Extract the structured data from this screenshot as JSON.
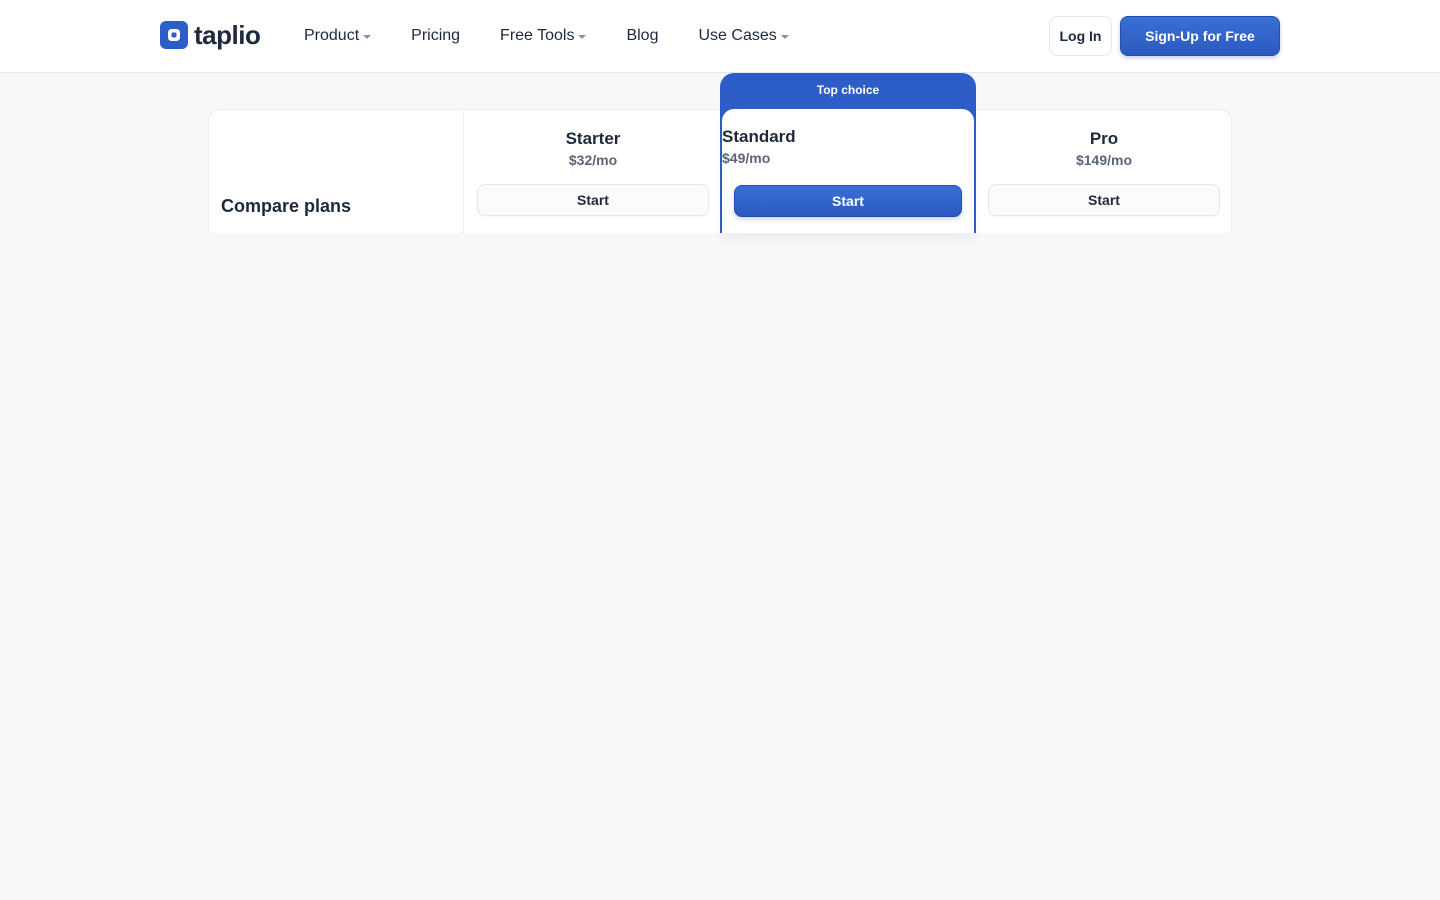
{
  "brand": {
    "name": "taplio",
    "accent": "#2d5ec7"
  },
  "nav": {
    "items": [
      {
        "label": "Product",
        "has_dropdown": true
      },
      {
        "label": "Pricing",
        "has_dropdown": false
      },
      {
        "label": "Free Tools",
        "has_dropdown": true
      },
      {
        "label": "Blog",
        "has_dropdown": false
      },
      {
        "label": "Use Cases",
        "has_dropdown": true
      }
    ],
    "login_label": "Log In",
    "signup_label": "Sign-Up for Free"
  },
  "compare": {
    "title": "Compare plans",
    "featured_badge": "Top choice",
    "plans": [
      {
        "name": "Starter",
        "price": "$32/mo",
        "cta": "Start",
        "featured": false
      },
      {
        "name": "Standard",
        "price": "$49/mo",
        "cta": "Start",
        "featured": true
      },
      {
        "name": "Pro",
        "price": "$149/mo",
        "cta": "Start",
        "featured": false
      }
    ]
  }
}
